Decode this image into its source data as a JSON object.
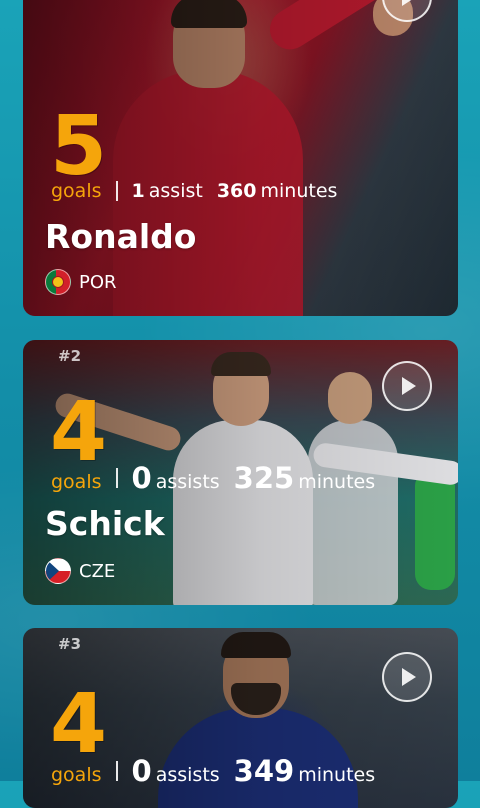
{
  "players": [
    {
      "rank": "",
      "goals": "5",
      "goals_label": "goals",
      "assists": "1",
      "assists_label": "assist",
      "minutes": "360",
      "minutes_label": "minutes",
      "name": "Ronaldo",
      "country": "POR",
      "flag_icon": "portugal-flag-icon"
    },
    {
      "rank": "#2",
      "goals": "4",
      "goals_label": "goals",
      "assists": "0",
      "assists_label": "assists",
      "minutes": "325",
      "minutes_label": "minutes",
      "name": "Schick",
      "country": "CZE",
      "flag_icon": "czech-flag-icon"
    },
    {
      "rank": "#3",
      "goals": "4",
      "goals_label": "goals",
      "assists": "0",
      "assists_label": "assists",
      "minutes": "349",
      "minutes_label": "minutes"
    }
  ],
  "colors": {
    "accent": "#f5a50b",
    "background": "#1aa3b8",
    "text": "#ffffff"
  },
  "icons": {
    "play": "play-icon"
  }
}
